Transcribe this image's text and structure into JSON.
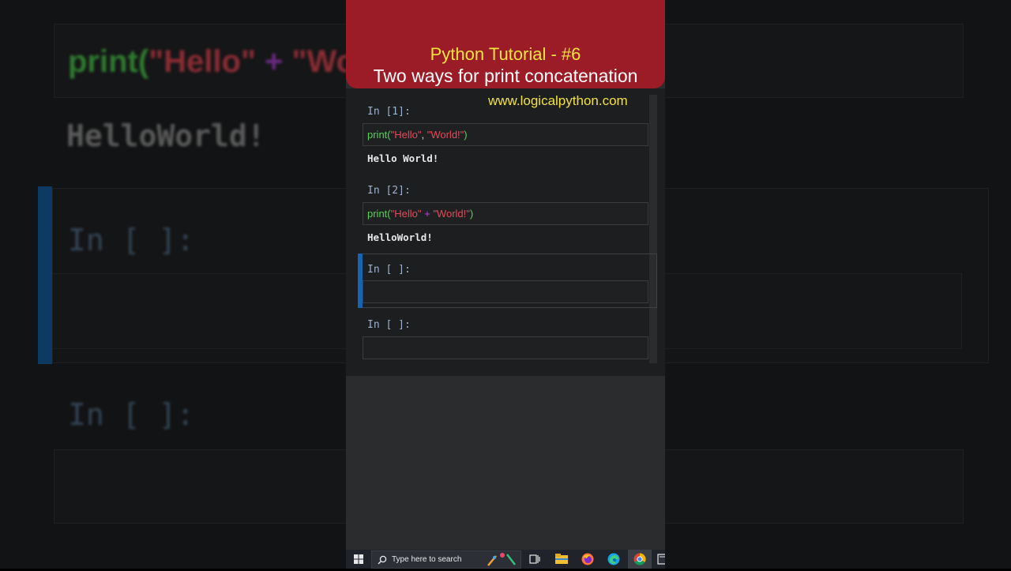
{
  "banner": {
    "title": "Python Tutorial - #6",
    "subtitle": "Two ways for print concatenation",
    "website": "www.logicalpython.com"
  },
  "notebook": {
    "cells": [
      {
        "prompt": "In [1]:",
        "code": {
          "fn": "print(",
          "s1": "\"Hello\"",
          "sep": ", ",
          "s2": "\"World!\"",
          "close": ")"
        },
        "output": "Hello World!"
      },
      {
        "prompt": "In [2]:",
        "code": {
          "fn": "print(",
          "s1": "\"Hello\"",
          "sep": " + ",
          "s2": "\"World!\"",
          "close": ")"
        },
        "output": "HelloWorld!"
      },
      {
        "prompt": "In [ ]:"
      },
      {
        "prompt": "In [ ]:"
      }
    ]
  },
  "backdrop": {
    "code_fn": "print(",
    "code_s1": "\"Hello\"",
    "code_op": "+",
    "code_s2": "\"Wo",
    "output": "HelloWorld!",
    "prompt1": "In [ ]:",
    "prompt2": "In [ ]:"
  },
  "taskbar": {
    "search_placeholder": "Type here to search",
    "icons": [
      "windows-start-icon",
      "search-icon",
      "task-view-icon",
      "file-explorer-icon",
      "firefox-icon",
      "edge-icon",
      "chrome-icon",
      "terminal-icon"
    ]
  },
  "colors": {
    "banner_bg": "#9b1c26",
    "banner_title": "#f4e242",
    "function": "#57d35a",
    "string": "#e44b5a",
    "operator": "#b444d8",
    "active_cell_bar": "#1565b0"
  }
}
